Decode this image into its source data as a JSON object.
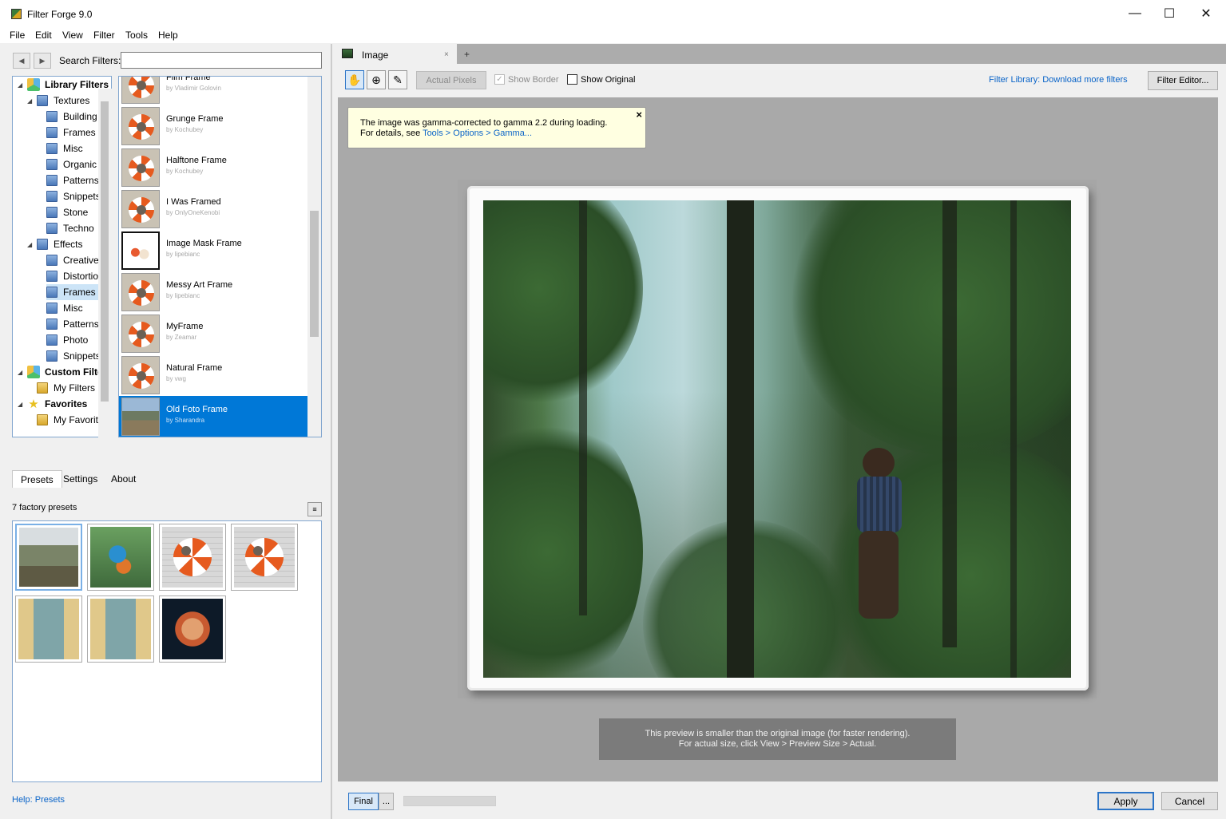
{
  "window": {
    "title": "Filter Forge 9.0",
    "minimize": "—",
    "maximize": "☐",
    "close": "✕"
  },
  "menu": [
    "File",
    "Edit",
    "View",
    "Filter",
    "Tools",
    "Help"
  ],
  "search": {
    "label": "Search Filters:",
    "value": "",
    "placeholder": ""
  },
  "tree": [
    {
      "label": "Library Filters",
      "bold": true,
      "icon": "cube-icon",
      "expander": "◢",
      "indent": 0
    },
    {
      "label": "Textures",
      "icon": "folder-icon",
      "expander": "◢",
      "indent": 1
    },
    {
      "label": "Building",
      "icon": "folder-icon",
      "indent": 2
    },
    {
      "label": "Frames",
      "icon": "folder-icon",
      "indent": 2
    },
    {
      "label": "Misc",
      "icon": "folder-icon",
      "indent": 2
    },
    {
      "label": "Organic",
      "icon": "folder-icon",
      "indent": 2
    },
    {
      "label": "Patterns",
      "icon": "folder-icon",
      "indent": 2
    },
    {
      "label": "Snippets",
      "icon": "folder-icon",
      "indent": 2
    },
    {
      "label": "Stone",
      "icon": "folder-icon",
      "indent": 2
    },
    {
      "label": "Techno",
      "icon": "folder-icon",
      "indent": 2
    },
    {
      "label": "Effects",
      "icon": "folder-icon",
      "expander": "◢",
      "indent": 1
    },
    {
      "label": "Creative",
      "icon": "folder-icon",
      "indent": 2
    },
    {
      "label": "Distortion",
      "icon": "folder-icon",
      "indent": 2
    },
    {
      "label": "Frames",
      "icon": "folder-icon",
      "indent": 2,
      "selected": true
    },
    {
      "label": "Misc",
      "icon": "folder-icon",
      "indent": 2
    },
    {
      "label": "Patterns",
      "icon": "folder-icon",
      "indent": 2
    },
    {
      "label": "Photo",
      "icon": "folder-icon",
      "indent": 2
    },
    {
      "label": "Snippets",
      "icon": "folder-icon",
      "indent": 2
    },
    {
      "label": "Custom Filters",
      "bold": true,
      "icon": "cube-icon",
      "expander": "◢",
      "indent": 0
    },
    {
      "label": "My Filters",
      "icon": "folder-yellow-icon",
      "indent": 1
    },
    {
      "label": "Favorites",
      "bold": true,
      "icon": "star-icon",
      "expander": "◢",
      "indent": 0
    },
    {
      "label": "My Favorites",
      "icon": "folder-yellow-icon",
      "indent": 1
    }
  ],
  "filters": [
    {
      "name": "Film Frame",
      "author": "by Vladimir Golovin",
      "thumb": "buoy"
    },
    {
      "name": "Grunge Frame",
      "author": "by Kochubey",
      "thumb": "buoy"
    },
    {
      "name": "Halftone Frame",
      "author": "by Kochubey",
      "thumb": "buoy"
    },
    {
      "name": "I Was Framed",
      "author": "by OnlyOneKenobi",
      "thumb": "buoy"
    },
    {
      "name": "Image Mask Frame",
      "author": "by lipebianc",
      "thumb": "flowers"
    },
    {
      "name": "Messy Art Frame",
      "author": "by lipebianc",
      "thumb": "buoy"
    },
    {
      "name": "MyFrame",
      "author": "by Zeamar",
      "thumb": "buoy"
    },
    {
      "name": "Natural Frame",
      "author": "by vwg",
      "thumb": "buoy"
    },
    {
      "name": "Old Foto Frame",
      "author": "by Sharandra",
      "thumb": "landscape",
      "selected": true
    }
  ],
  "tabs": [
    "Presets",
    "Settings",
    "About"
  ],
  "presets": {
    "count_label": "7 factory presets",
    "menu_icon": "≡",
    "items": [
      "tree",
      "kingfisher",
      "buoy",
      "buoy",
      "window",
      "window",
      "lionfish"
    ]
  },
  "help_link": "Help: Presets",
  "doc": {
    "tab_label": "Image",
    "tab_close": "×",
    "add_tab": "+"
  },
  "toolbar": {
    "actual_pixels": "Actual Pixels",
    "show_border": "Show Border",
    "show_original": "Show Original",
    "library_link": "Filter Library: Download more filters",
    "filter_editor": "Filter Editor..."
  },
  "gamma_note": {
    "line1": "The image was gamma-corrected to gamma 2.2 during loading.",
    "line2_prefix": "For details, see ",
    "line2_link": "Tools > Options > Gamma...",
    "close": "×"
  },
  "preview_note": {
    "line1": "This preview is smaller than the original image (for faster rendering).",
    "line2": "For actual size, click View > Preview Size > Actual."
  },
  "bottom": {
    "final": "Final",
    "more": "...",
    "apply": "Apply",
    "cancel": "Cancel"
  },
  "colors": {
    "accent": "#0078d7",
    "link": "#0a64c8",
    "note_bg": "#ffffe1"
  }
}
